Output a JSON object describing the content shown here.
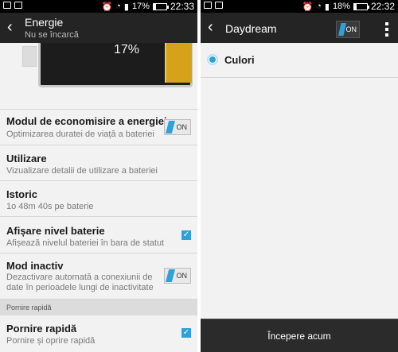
{
  "left": {
    "status": {
      "icons": [
        "photo-icon",
        "usb-icon"
      ],
      "right_icons": [
        "alarm-icon",
        "wifi-icon",
        "signal-icon"
      ],
      "battery": "17%",
      "battery_level": 0.17,
      "time": "22:33"
    },
    "appbar": {
      "title": "Energie",
      "subtitle": "Nu se încarcă"
    },
    "battery_graphic": {
      "percent": "17%",
      "level_color": "#d6a21a"
    },
    "items": [
      {
        "title": "Modul de economisire a energiei",
        "desc": "Optimizarea duratei de viață a bateriei",
        "control": "toggle",
        "toggle_label": "ON"
      },
      {
        "title": "Utilizare",
        "desc": "Vizualizare detalii de utilizare a bateriei"
      },
      {
        "title": "Istoric",
        "desc": "1o 48m 40s pe baterie"
      },
      {
        "title": "Afișare nivel baterie",
        "desc": "Afișează nivelul bateriei în bara de statut",
        "control": "checkbox",
        "checked": true
      },
      {
        "title": "Mod inactiv",
        "desc": "Dezactivare automată a conexiunii de date în perioadele lungi de inactivitate",
        "control": "toggle",
        "toggle_label": "ON"
      }
    ],
    "section_header": "Pornire rapidă",
    "quick_boot": {
      "title": "Pornire rapidă",
      "desc": "Pornire și oprire rapidă",
      "checked": true
    }
  },
  "right": {
    "status": {
      "icons": [
        "photo-icon",
        "usb-icon"
      ],
      "right_icons": [
        "alarm-icon",
        "wifi-icon",
        "signal-icon"
      ],
      "battery": "18%",
      "battery_level": 0.18,
      "time": "22:32"
    },
    "appbar": {
      "title": "Daydream",
      "toggle_label": "ON"
    },
    "option": {
      "label": "Culori",
      "selected": true
    },
    "bottom_button": "Începere acum"
  },
  "colors": {
    "accent": "#2fa0d8",
    "appbar": "#242424",
    "background": "#f2f2f2"
  }
}
